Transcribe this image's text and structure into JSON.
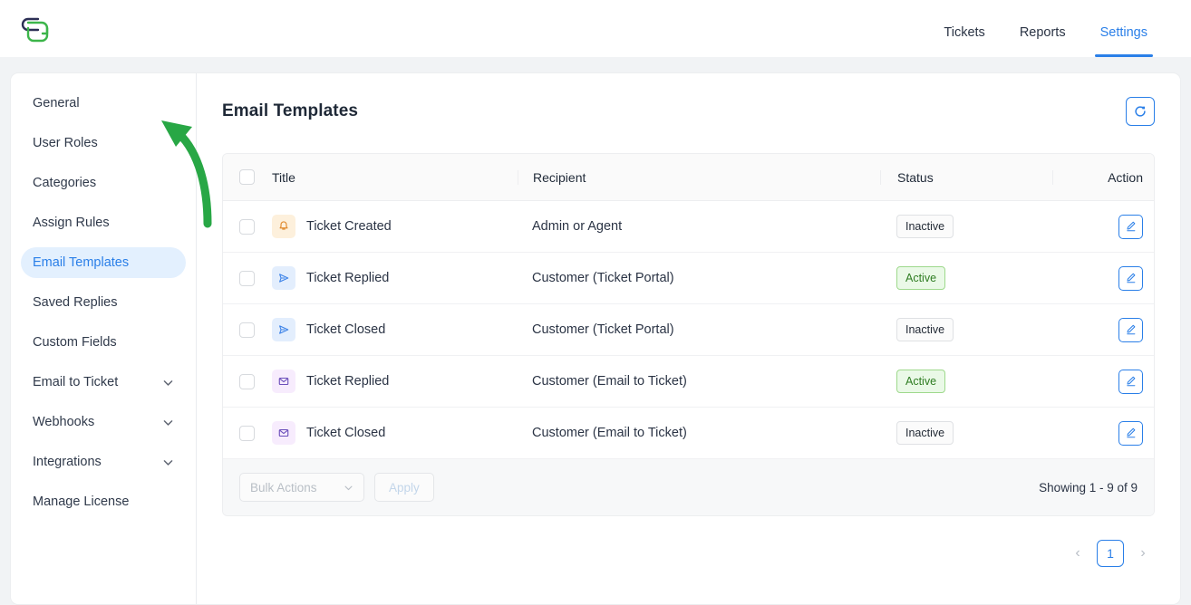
{
  "brand": {
    "logo_alt": "SG",
    "logo_dark": "#2c2f55",
    "logo_green": "#3cb54a"
  },
  "accent": {
    "blue": "#2a7fe8",
    "green": "#2f7d22",
    "green_bg": "#eaf9e7"
  },
  "topnav": {
    "items": [
      {
        "label": "Tickets",
        "active": false
      },
      {
        "label": "Reports",
        "active": false
      },
      {
        "label": "Settings",
        "active": true
      }
    ]
  },
  "sidebar": {
    "items": [
      {
        "label": "General",
        "expandable": false,
        "active": false
      },
      {
        "label": "User Roles",
        "expandable": false,
        "active": false
      },
      {
        "label": "Categories",
        "expandable": false,
        "active": false
      },
      {
        "label": "Assign Rules",
        "expandable": false,
        "active": false
      },
      {
        "label": "Email Templates",
        "expandable": false,
        "active": true
      },
      {
        "label": "Saved Replies",
        "expandable": false,
        "active": false
      },
      {
        "label": "Custom Fields",
        "expandable": false,
        "active": false
      },
      {
        "label": "Email to Ticket",
        "expandable": true,
        "active": false
      },
      {
        "label": "Webhooks",
        "expandable": true,
        "active": false
      },
      {
        "label": "Integrations",
        "expandable": true,
        "active": false
      },
      {
        "label": "Manage License",
        "expandable": false,
        "active": false
      }
    ]
  },
  "main": {
    "title": "Email Templates",
    "refresh_icon": "refresh-icon",
    "table": {
      "headers": [
        "Title",
        "Recipient",
        "Status",
        "Action"
      ],
      "rows": [
        {
          "title": "Ticket Created",
          "recipient": "Admin or Agent",
          "status": "Inactive",
          "icon": "bell-icon",
          "icon_style": "ic-bell"
        },
        {
          "title": "Ticket Replied",
          "recipient": "Customer (Ticket Portal)",
          "status": "Active",
          "icon": "send-icon",
          "icon_style": "ic-send"
        },
        {
          "title": "Ticket Closed",
          "recipient": "Customer (Ticket Portal)",
          "status": "Inactive",
          "icon": "send-icon",
          "icon_style": "ic-send"
        },
        {
          "title": "Ticket Replied",
          "recipient": "Customer (Email to Ticket)",
          "status": "Active",
          "icon": "envelope-icon",
          "icon_style": "ic-mail"
        },
        {
          "title": "Ticket Closed",
          "recipient": "Customer (Email to Ticket)",
          "status": "Inactive",
          "icon": "envelope-icon",
          "icon_style": "ic-mail"
        }
      ]
    },
    "footer": {
      "bulk_actions_label": "Bulk Actions",
      "apply_label": "Apply",
      "showing": "Showing 1 - 9 of 9"
    },
    "pagination": {
      "prev": "‹",
      "next": "›",
      "pages": [
        "1"
      ],
      "current": "1"
    }
  },
  "annotation": {
    "type": "green-curved-arrow",
    "points_to": "Email Templates",
    "color": "#28a745"
  }
}
